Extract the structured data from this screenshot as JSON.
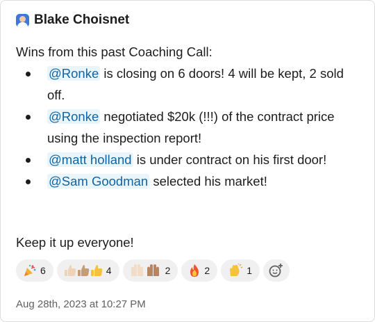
{
  "author": {
    "name": "Blake Choisnet"
  },
  "message": {
    "intro": "Wins from this past Coaching Call:",
    "items": [
      {
        "mention": "@Ronke",
        "text": " is closing on 6 doors! 4 will be kept, 2 sold off."
      },
      {
        "mention": "@Ronke",
        "text": " negotiated $20k (!!!) of the contract price using the inspection report!"
      },
      {
        "mention": "@matt holland",
        "text": " is under contract on his first door!"
      },
      {
        "mention": "@Sam Goodman",
        "text": " selected his market!"
      }
    ],
    "outro": "Keep it up everyone!"
  },
  "reactions": [
    {
      "icon": "party-popper-icon",
      "count": "6"
    },
    {
      "icon": "thumbs-up-icon",
      "count": "4"
    },
    {
      "icon": "raised-hands-icon",
      "count": "2"
    },
    {
      "icon": "fire-icon",
      "count": "2"
    },
    {
      "icon": "clapping-hands-icon",
      "count": "1"
    }
  ],
  "add_reaction_icon": "add-reaction-icon",
  "timestamp": "Aug 28th, 2023 at 10:27 PM"
}
